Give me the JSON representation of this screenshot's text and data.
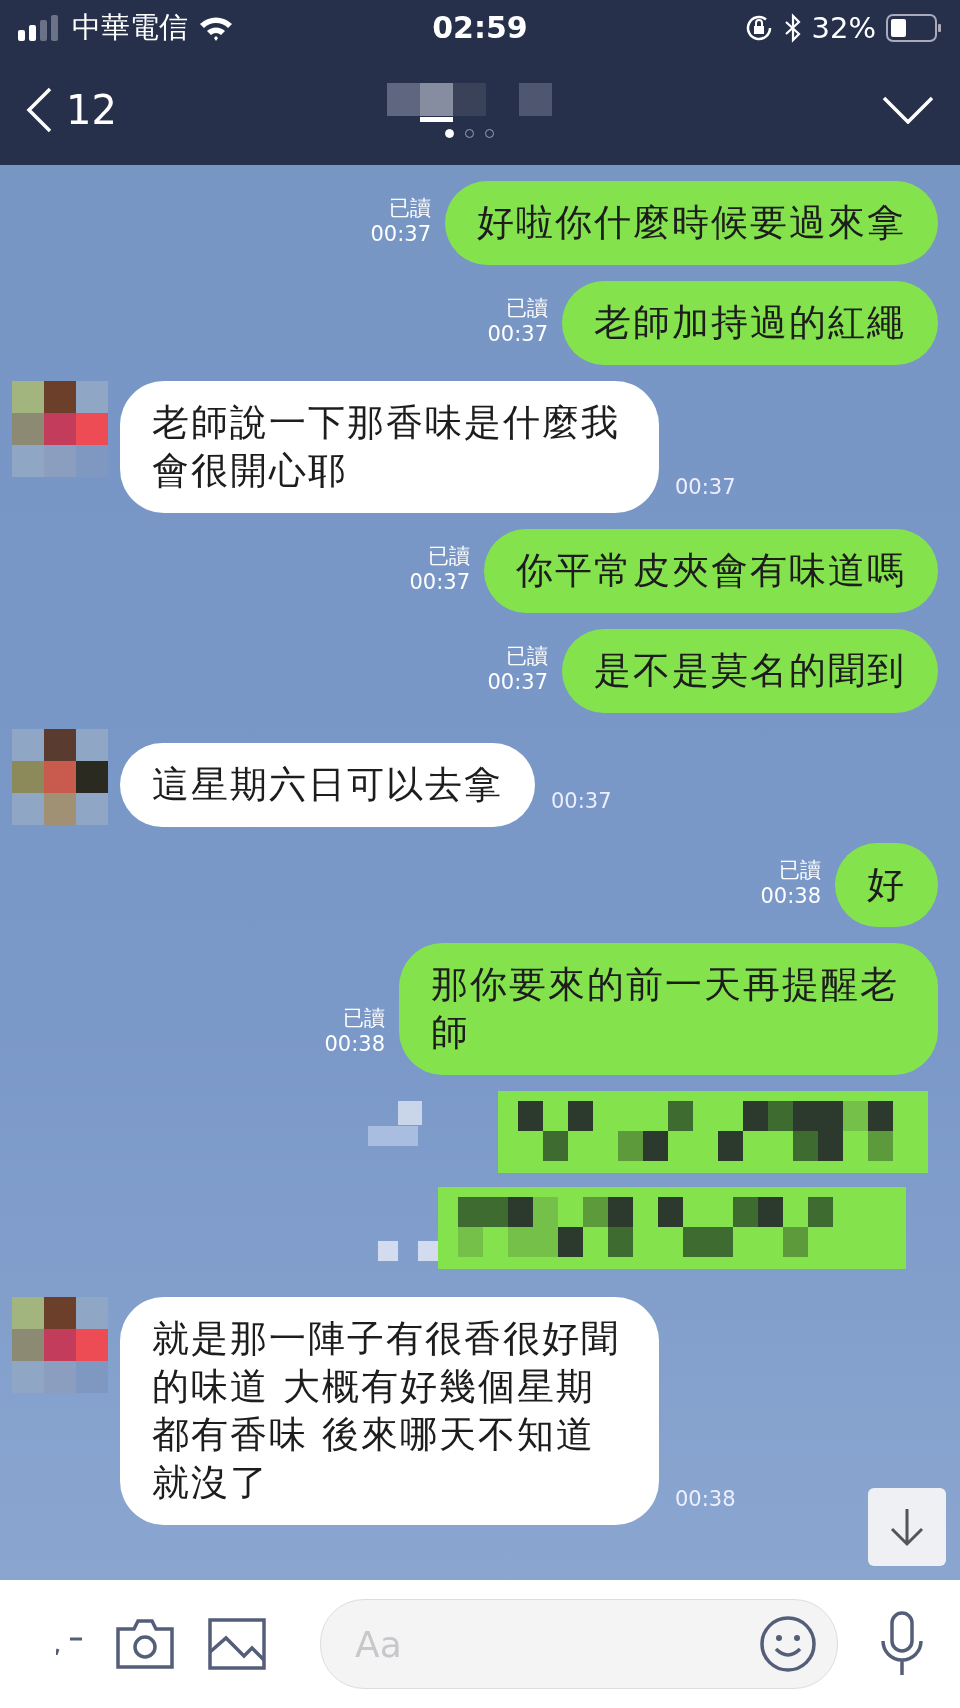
{
  "status_bar": {
    "carrier": "中華電信",
    "time": "02:59",
    "battery": "32%"
  },
  "header": {
    "unread_count": "12",
    "pages": [
      {
        "selected": true
      },
      {
        "selected": false
      },
      {
        "selected": false
      }
    ]
  },
  "messages": [
    {
      "kind": "sent",
      "text": "好啦你什麼時候要過來拿",
      "read_label": "已讀",
      "time": "00:37"
    },
    {
      "kind": "sent",
      "text": "老師加持過的紅繩",
      "read_label": "已讀",
      "time": "00:37"
    },
    {
      "kind": "received",
      "text": "老師說一下那香味是什麼我會很開心耶",
      "time": "00:37"
    },
    {
      "kind": "sent",
      "text": "你平常皮夾會有味道嗎",
      "read_label": "已讀",
      "time": "00:37"
    },
    {
      "kind": "sent",
      "text": "是不是莫名的聞到",
      "read_label": "已讀",
      "time": "00:37"
    },
    {
      "kind": "received",
      "text": "這星期六日可以去拿",
      "time": "00:37"
    },
    {
      "kind": "sent",
      "text": "好",
      "read_label": "已讀",
      "time": "00:38"
    },
    {
      "kind": "sent",
      "text": "那你要來的前一天再提醒老師",
      "read_label": "已讀",
      "time": "00:38"
    },
    {
      "kind": "redacted"
    },
    {
      "kind": "received",
      "text": "就是那一陣子有很香很好聞的味道 大概有好幾個星期都有香味 後來哪天不知道就沒了",
      "time": "00:38"
    }
  ],
  "input": {
    "placeholder": "Aa"
  }
}
